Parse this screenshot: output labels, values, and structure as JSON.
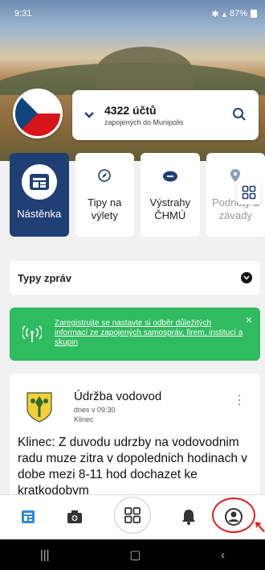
{
  "status_bar": {
    "time": "9:31",
    "battery": "87%",
    "icons": [
      "bluetooth-icon",
      "wifi-icon",
      "signal-icon",
      "battery-icon"
    ]
  },
  "counter": {
    "count": "4322 účtů",
    "subtitle": "zapojených do Munipolis"
  },
  "tiles": [
    {
      "label": "Nástěnka",
      "icon": "board-icon",
      "active": true
    },
    {
      "label": "Tipy na výlety",
      "icon": "compass-icon",
      "active": false
    },
    {
      "label": "Výstrahy ČHMÚ",
      "icon": "cloud-warning-icon",
      "active": false
    },
    {
      "label": "Podněty a závady",
      "icon": "pin-icon",
      "active": false
    }
  ],
  "filter": {
    "label": "Typy zpráv"
  },
  "banner": {
    "text": "Zaregistrujte se nastavte si odběr důležitých informací ze zapojených samospráv, firem, institucí a skupin",
    "close": "×"
  },
  "post": {
    "title": "Údržba vodovod",
    "date": "dnes v 09:30",
    "place": "Klinec",
    "body": "Klinec: Z duvodu udrzby na vodovodnim radu muze zitra v dopolednich hodinach v dobe mezi 8-11 hod dochazet ke kratkodobym"
  },
  "bottom_nav": [
    "news-icon",
    "camera-plus-icon",
    "grid-icon",
    "bell-icon",
    "profile-icon"
  ],
  "colors": {
    "primary": "#1f3f75",
    "banner": "#2fbb5f",
    "highlight": "#e02020"
  }
}
